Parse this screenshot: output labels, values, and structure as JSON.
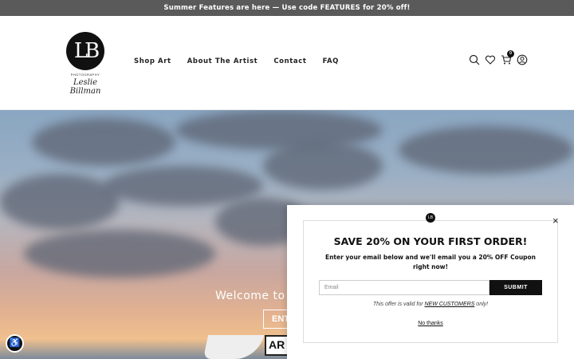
{
  "announcement": "Summer Features are here — Use code FEATURES for 20% off!",
  "logo": {
    "mark": "LB",
    "tagline": "PHOTOGRAPHY",
    "signature": "Leslie Billman"
  },
  "nav": {
    "items": [
      "Shop Art",
      "About The Artist",
      "Contact",
      "FAQ"
    ]
  },
  "header_icons": {
    "search": "search-icon",
    "wishlist": "heart-icon",
    "cart": "cart-icon",
    "account": "user-icon",
    "cart_count": "0"
  },
  "hero": {
    "title_visible": "Welcome to",
    "button_visible": "ENT",
    "badge_visible": "AR"
  },
  "popup": {
    "logo_mark": "LB",
    "title": "SAVE 20% ON YOUR FIRST ORDER!",
    "text": "Enter your email below and we'll email you a 20% OFF Coupon right now!",
    "email_placeholder": "Email",
    "submit_label": "SUBMIT",
    "note_prefix": "This offer is valid for ",
    "note_link": "NEW CUSTOMERS",
    "note_suffix": " only!",
    "no_thanks": "No thanks",
    "close": "×"
  },
  "accessibility_icon": "accessibility-icon",
  "colors": {
    "announcement_bg": "#5a5a5a",
    "button_black": "#111111"
  }
}
